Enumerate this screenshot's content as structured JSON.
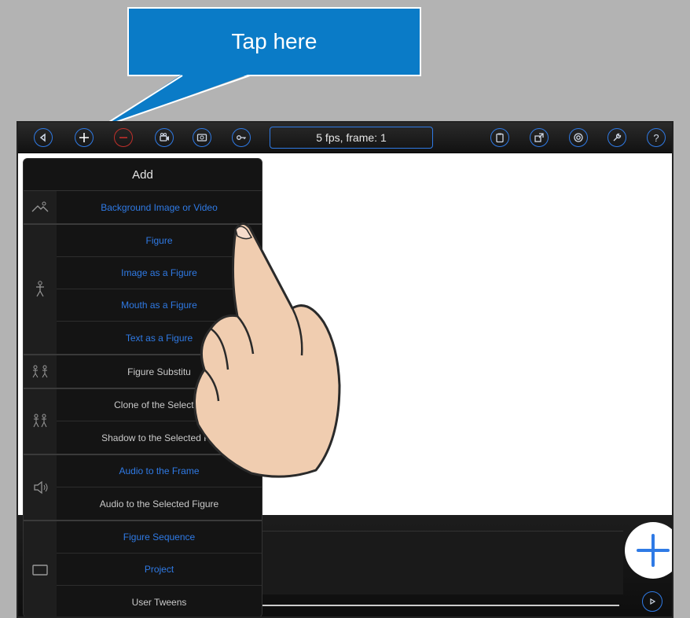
{
  "callout": {
    "text": "Tap here"
  },
  "toolbar": {
    "status": "5 fps, frame: 1",
    "buttons": [
      "back",
      "add",
      "remove",
      "camera",
      "photo",
      "key",
      "clipboard",
      "external",
      "target",
      "wrench",
      "help"
    ]
  },
  "menu": {
    "title": "Add",
    "groups": [
      {
        "icon": "background-icon",
        "items": [
          {
            "label": "Background Image or Video",
            "color": "blue"
          }
        ]
      },
      {
        "icon": "figure-icon",
        "items": [
          {
            "label": "Figure",
            "color": "blue"
          },
          {
            "label": "Image as a Figure",
            "color": "blue"
          },
          {
            "label": "Mouth as a Figure",
            "color": "blue"
          },
          {
            "label": "Text as a Figure",
            "color": "blue"
          }
        ]
      },
      {
        "icon": "figure-substitute-icon",
        "items": [
          {
            "label": "Figure Substitu",
            "color": "gray"
          }
        ]
      },
      {
        "icon": "clone-icon",
        "items": [
          {
            "label": "Clone of the Selected",
            "color": "gray"
          },
          {
            "label": "Shadow to the Selected Fig",
            "color": "gray"
          }
        ]
      },
      {
        "icon": "speaker-icon",
        "items": [
          {
            "label": "Audio to the Frame",
            "color": "blue"
          },
          {
            "label": "Audio to the Selected Figure",
            "color": "gray"
          }
        ]
      },
      {
        "icon": "screen-icon",
        "items": [
          {
            "label": "Figure Sequence",
            "color": "blue"
          },
          {
            "label": "Project",
            "color": "blue"
          },
          {
            "label": "User Tweens",
            "color": "gray"
          }
        ]
      }
    ]
  },
  "colors": {
    "accent": "#2f7ae5",
    "callout": "#0a7bc7",
    "remove": "#c0302b"
  }
}
